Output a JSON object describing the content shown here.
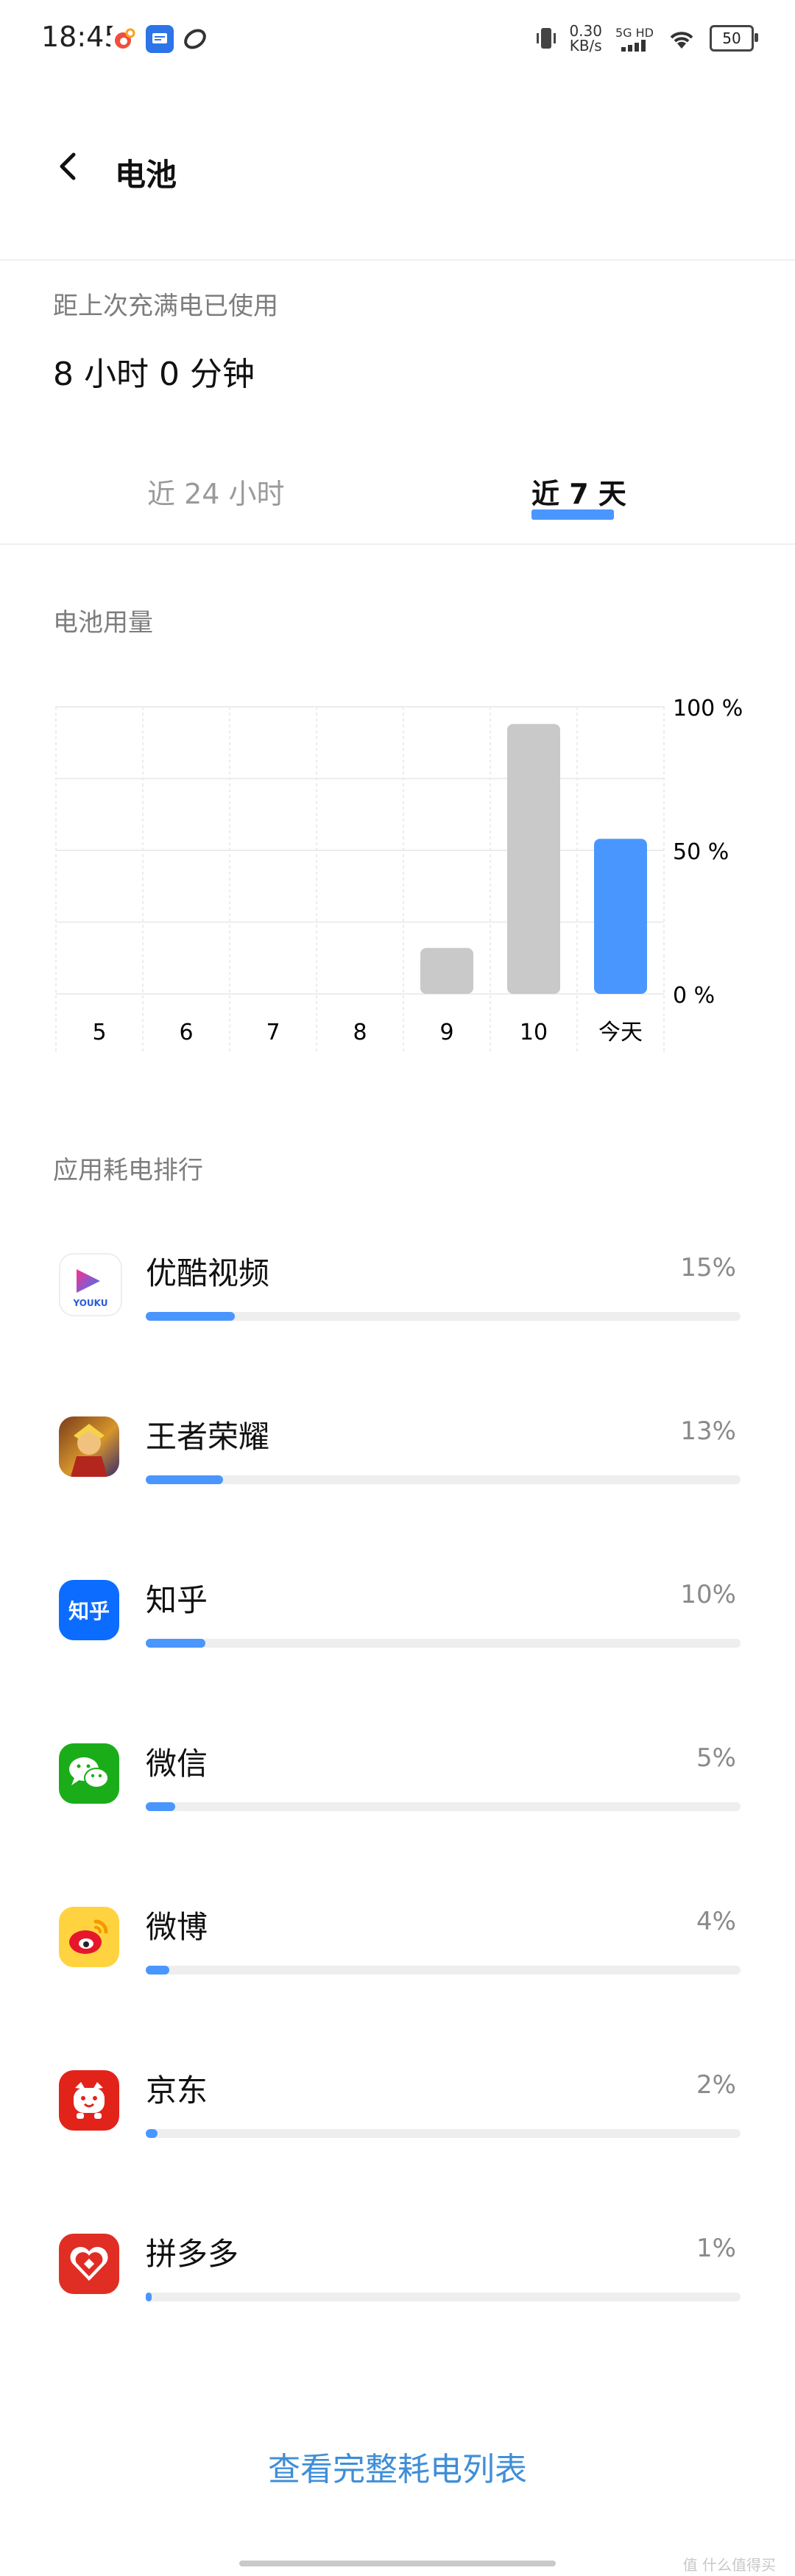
{
  "status_bar": {
    "time": "18:45",
    "app_badges": [
      "weibo",
      "notice",
      "app"
    ],
    "net_speed": "0.30\nKB/s",
    "signal": "5G HD",
    "battery_level": "50"
  },
  "header": {
    "title": "电池"
  },
  "summary": {
    "label": "距上次充满电已使用",
    "value": "8 小时 0 分钟"
  },
  "tabs": [
    {
      "label": "近 24 小时",
      "active": false
    },
    {
      "label": "近 7 天",
      "active": true
    }
  ],
  "chart_section": {
    "title": "电池用量"
  },
  "chart_data": {
    "type": "bar",
    "categories": [
      "5",
      "6",
      "7",
      "8",
      "9",
      "10",
      "今天"
    ],
    "values": [
      0,
      0,
      0,
      0,
      16,
      94,
      54
    ],
    "highlight_index": 6,
    "ylim": [
      0,
      100
    ],
    "yticks": [
      "0 %",
      "50 %",
      "100 %"
    ],
    "grid": true,
    "colors": {
      "normal": "#c9c9c9",
      "highlight": "#4a96ff"
    }
  },
  "ranking": {
    "title": "应用耗电排行",
    "apps": [
      {
        "name": "优酷视频",
        "percent": "15%",
        "fraction": 0.15,
        "icon": "youku-icon"
      },
      {
        "name": "王者荣耀",
        "percent": "13%",
        "fraction": 0.13,
        "icon": "honor-of-kings-icon"
      },
      {
        "name": "知乎",
        "percent": "10%",
        "fraction": 0.1,
        "icon": "zhihu-icon"
      },
      {
        "name": "微信",
        "percent": "5%",
        "fraction": 0.05,
        "icon": "wechat-icon"
      },
      {
        "name": "微博",
        "percent": "4%",
        "fraction": 0.04,
        "icon": "weibo-icon"
      },
      {
        "name": "京东",
        "percent": "2%",
        "fraction": 0.02,
        "icon": "jd-icon"
      },
      {
        "name": "拼多多",
        "percent": "1%",
        "fraction": 0.01,
        "icon": "pinduoduo-icon"
      }
    ],
    "youku_icon_text": "YOUKU",
    "zhihu_icon_text": "知乎"
  },
  "footer": {
    "link_label": "查看完整耗电列表"
  },
  "watermark": "值 什么值得买"
}
